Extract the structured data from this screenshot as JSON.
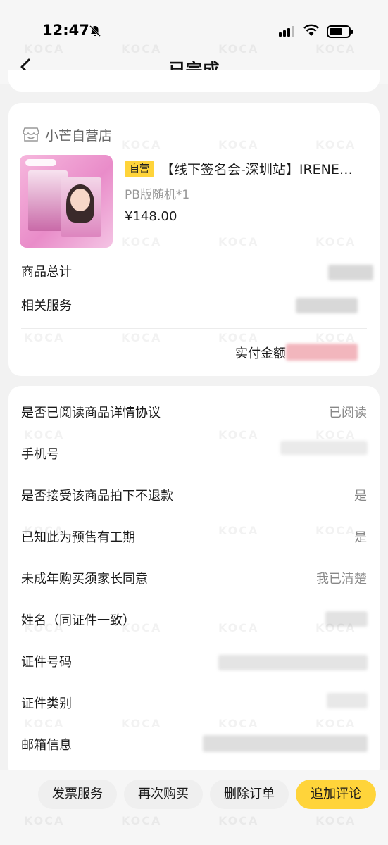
{
  "status_bar": {
    "time": "12:47"
  },
  "nav": {
    "title": "已完成"
  },
  "store": {
    "name": "小芒自营店"
  },
  "product": {
    "badge": "自营",
    "title": "【线下签名会-深圳站】IRENE…",
    "spec": "PB版随机*1",
    "price": "¥148.00"
  },
  "summary": {
    "goods_total_label": "商品总计",
    "services_label": "相关服务",
    "paid_label": "实付金额"
  },
  "form": {
    "rows": [
      {
        "label": "是否已阅读商品详情协议",
        "value": "已阅读"
      },
      {
        "label": "手机号",
        "value": ""
      },
      {
        "label": "是否接受该商品拍下不退款",
        "value": "是"
      },
      {
        "label": "已知此为预售有工期",
        "value": "是"
      },
      {
        "label": "未成年购买须家长同意",
        "value": "我已清楚"
      },
      {
        "label": "姓名（同证件一致）",
        "value": ""
      },
      {
        "label": "证件号码",
        "value": ""
      },
      {
        "label": "证件类别",
        "value": ""
      },
      {
        "label": "邮箱信息",
        "value": ""
      }
    ]
  },
  "actions": {
    "invoice": "发票服务",
    "rebuy": "再次购买",
    "delete": "删除订单",
    "review": "追加评论"
  },
  "watermark": "KOCA",
  "colors": {
    "accent": "#ffd43a",
    "muted": "#888888"
  }
}
